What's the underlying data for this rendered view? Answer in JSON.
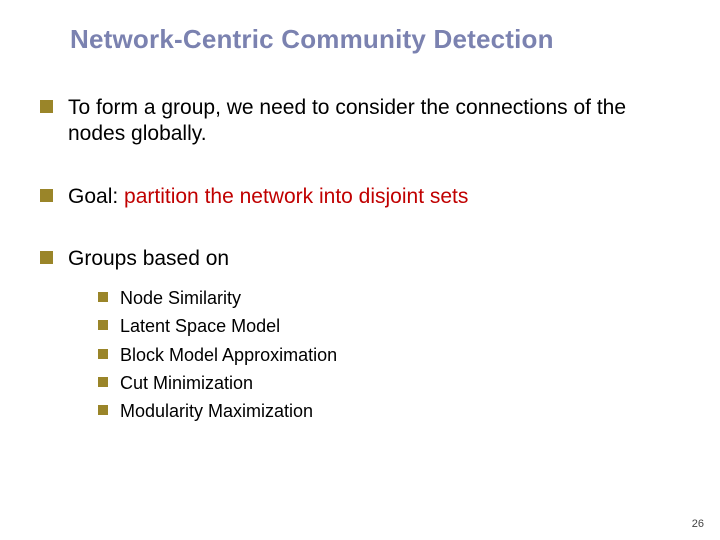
{
  "title": "Network-Centric Community Detection",
  "bullets": [
    {
      "text": "To form a group, we need to consider the connections of the nodes globally."
    },
    {
      "prefix": "Goal: ",
      "highlight": "partition the network into disjoint sets"
    },
    {
      "text": "Groups based on",
      "sub": [
        "Node Similarity",
        "Latent Space Model",
        "Block Model Approximation",
        "Cut Minimization",
        "Modularity Maximization"
      ]
    }
  ],
  "page_number": "26"
}
